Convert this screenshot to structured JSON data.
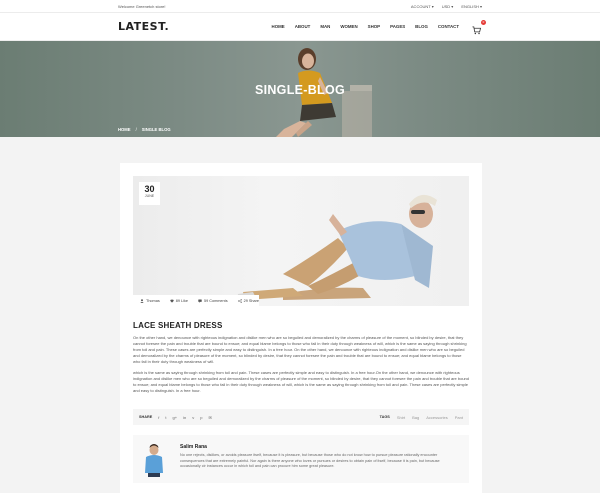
{
  "topbar": {
    "welcome": "Welcome Greenetch store!",
    "account": "ACCOUNT",
    "currency": "USD",
    "language": "ENGLISH"
  },
  "nav": {
    "logo": "LATEST.",
    "items": [
      "HOME",
      "ABOUT",
      "MAN",
      "WOMEN",
      "SHOP",
      "PAGES",
      "BLOG",
      "CONTACT"
    ],
    "cart_count": "0"
  },
  "hero": {
    "title": "SINGLE-BLOG",
    "breadcrumb": [
      "HOME",
      "SINGLE BLOG"
    ],
    "separator": "/"
  },
  "post": {
    "date_day": "30",
    "date_month": "JUNE",
    "author": "Thomas",
    "likes": "89 Like",
    "comments": "59 Comments",
    "shares": "29 Share",
    "title": "LACE SHEATH DRESS",
    "paragraph1": "On the other hand, we denounce with righteous indignation and dislike men who are so beguiled and demoralized by the charms of pleasure of the moment, so blinded by desire, that they cannot foresee the pain and trouble that are bound to ensue; and equal blame belongs to those who fail in their duty through weakness of will, which is the same as saying through shrinking from toil and pain. These cases are perfectly simple and easy to distinguish. In a free hour. On the other hand, we denounce with righteous indignation and dislike men who are so beguiled and demoralized by the charms of pleasure of the moment, so blinded by desire, that they cannot foresee the pain and trouble that are bound to ensue; and equal blame belongs to those who fail in their duty through weakness of will.",
    "paragraph2": "which is the same as saying through shrinking from toil and pain. These cases are perfectly simple and easy to distinguish. In a free hour.On the other hand, we denounce with righteous indignation and dislike men who are so beguiled and demoralized by the charms of pleasure of the moment, so blinded by desire, that they cannot foresee the pain and trouble that are bound to ensue; and equal blame belongs to those who fail in their duty through weakness of will, which is the same as saying through shrinking from toil and pain. These cases are perfectly simple and easy to distinguish. In a free hour."
  },
  "share": {
    "label": "SHARE",
    "icons": [
      "f",
      "t",
      "g+",
      "in",
      "v",
      "p",
      "✉"
    ],
    "tags_label": "TAGS",
    "tags": [
      "Shirt",
      "Bag",
      "Accessories",
      "Pant"
    ]
  },
  "author_box": {
    "name": "Salim Rana",
    "bio": "No one rejects, dislikes, or avoids pleasure itself, because it is pleasure, but because those who do not know how to pursue pleasure rationally encounter consequences that are extremely painful. Nor again is there anyone who loves or pursues or desires to obtain pain of itself, because it is pain, but because occasionally cir instances occur in which toil and pain can procure him some great pleasure."
  },
  "colors": {
    "hero_overlay": "#7c8b84",
    "badge": "#e53935"
  }
}
